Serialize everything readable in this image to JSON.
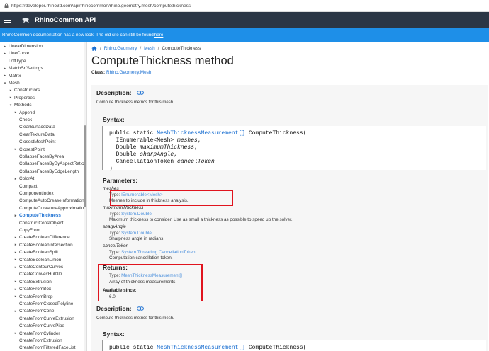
{
  "browser": {
    "url": "https://developer.rhino3d.com/api/rhinocommon/rhino.geometry.mesh/computethickness"
  },
  "header": {
    "title": "RhinoCommon API"
  },
  "notice": {
    "text": "RhinoCommon documentation has a new look. The old site can still be found ",
    "link": "here"
  },
  "sidebar": {
    "items": [
      {
        "label": "LinearDimension",
        "indent": 1,
        "toggle": "▸"
      },
      {
        "label": "LineCurve",
        "indent": 1,
        "toggle": "▸"
      },
      {
        "label": "LoftType",
        "indent": 1,
        "toggle": ""
      },
      {
        "label": "MatchSrfSettings",
        "indent": 1,
        "toggle": "▸"
      },
      {
        "label": "Matrix",
        "indent": 1,
        "toggle": "▸"
      },
      {
        "label": "Mesh",
        "indent": 1,
        "toggle": "▾"
      },
      {
        "label": "Constructors",
        "indent": 2,
        "toggle": "▸"
      },
      {
        "label": "Properties",
        "indent": 2,
        "toggle": "▸"
      },
      {
        "label": "Methods",
        "indent": 2,
        "toggle": "▾"
      },
      {
        "label": "Append",
        "indent": 3,
        "toggle": "▸"
      },
      {
        "label": "Check",
        "indent": 3,
        "toggle": ""
      },
      {
        "label": "ClearSurfaceData",
        "indent": 3,
        "toggle": ""
      },
      {
        "label": "ClearTextureData",
        "indent": 3,
        "toggle": ""
      },
      {
        "label": "ClosestMeshPoint",
        "indent": 3,
        "toggle": ""
      },
      {
        "label": "ClosestPoint",
        "indent": 3,
        "toggle": "▸"
      },
      {
        "label": "CollapseFacesByArea",
        "indent": 3,
        "toggle": ""
      },
      {
        "label": "CollapseFacesByByAspectRatio",
        "indent": 3,
        "toggle": ""
      },
      {
        "label": "CollapseFacesByEdgeLength",
        "indent": 3,
        "toggle": ""
      },
      {
        "label": "ColorAt",
        "indent": 3,
        "toggle": "▸"
      },
      {
        "label": "Compact",
        "indent": 3,
        "toggle": ""
      },
      {
        "label": "ComponentIndex",
        "indent": 3,
        "toggle": ""
      },
      {
        "label": "ComputeAutoCreaseInformation",
        "indent": 3,
        "toggle": ""
      },
      {
        "label": "ComputeCurvatureApproximation",
        "indent": 3,
        "toggle": ""
      },
      {
        "label": "ComputeThickness",
        "indent": 3,
        "toggle": "▸",
        "active": true
      },
      {
        "label": "ConstructConstObject",
        "indent": 3,
        "toggle": ""
      },
      {
        "label": "CopyFrom",
        "indent": 3,
        "toggle": ""
      },
      {
        "label": "CreateBooleanDifference",
        "indent": 3,
        "toggle": "▸"
      },
      {
        "label": "CreateBooleanIntersection",
        "indent": 3,
        "toggle": "▸"
      },
      {
        "label": "CreateBooleanSplit",
        "indent": 3,
        "toggle": "▸"
      },
      {
        "label": "CreateBooleanUnion",
        "indent": 3,
        "toggle": "▸"
      },
      {
        "label": "CreateContourCurves",
        "indent": 3,
        "toggle": "▸"
      },
      {
        "label": "CreateConvexHull3D",
        "indent": 3,
        "toggle": ""
      },
      {
        "label": "CreateExtrusion",
        "indent": 3,
        "toggle": "▸"
      },
      {
        "label": "CreateFromBox",
        "indent": 3,
        "toggle": "▸"
      },
      {
        "label": "CreateFromBrep",
        "indent": 3,
        "toggle": "▸"
      },
      {
        "label": "CreateFromClosedPolyline",
        "indent": 3,
        "toggle": ""
      },
      {
        "label": "CreateFromCone",
        "indent": 3,
        "toggle": "▸"
      },
      {
        "label": "CreateFromCurveExtrusion",
        "indent": 3,
        "toggle": ""
      },
      {
        "label": "CreateFromCurvePipe",
        "indent": 3,
        "toggle": ""
      },
      {
        "label": "CreateFromCylinder",
        "indent": 3,
        "toggle": "▸"
      },
      {
        "label": "CreateFromExtrusion",
        "indent": 3,
        "toggle": ""
      },
      {
        "label": "CreateFromFilteredFaceList",
        "indent": 3,
        "toggle": ""
      }
    ]
  },
  "breadcrumb": {
    "items": [
      "Rhino.Geometry",
      "Mesh"
    ],
    "current": "ComputeThickness"
  },
  "page": {
    "title": "ComputeThickness method",
    "class_label": "Class:",
    "class_value": "Rhino.Geometry.Mesh"
  },
  "section1": {
    "description_title": "Description:",
    "description_text": "Compute thickness metrics for this mesh.",
    "syntax_title": "Syntax:",
    "code": {
      "line1_pre": "public static ",
      "line1_type": "MeshThicknessMeasurement[]",
      "line1_post": " ComputeThickness(",
      "line2": "  IEnumerable<Mesh> ",
      "line2_param": "meshes",
      "line3": "  Double ",
      "line3_param": "maximumThickness",
      "line4": "  Double ",
      "line4_param": "sharpAngle",
      "line5": "  CancellationToken ",
      "line5_param": "cancelToken",
      "line6": ")"
    },
    "parameters_title": "Parameters:",
    "params": [
      {
        "name": "meshes",
        "type_label": "Type: ",
        "type": "IEnumerable<Mesh>",
        "desc": "Meshes to include in thickness analysis."
      },
      {
        "name": "maximumThickness",
        "type_label": "Type: ",
        "type": "System.Double",
        "desc": "Maximum thickness to consider. Use as small a thickness as possible to speed up the solver."
      },
      {
        "name": "sharpAngle",
        "type_label": "Type: ",
        "type": "System.Double",
        "desc": "Sharpness angle in radians."
      },
      {
        "name": "cancelToken",
        "type_label": "Type: ",
        "type": "System.Threading.CancellationToken",
        "desc": "Computation cancellation token."
      }
    ],
    "returns_title": "Returns:",
    "returns_type_label": "Type: ",
    "returns_type": "MeshThicknessMeasurement[]",
    "returns_desc": "Array of thickness measurements.",
    "available_label": "Available since:",
    "available_value": "6.0"
  },
  "section2": {
    "description_title": "Description:",
    "description_text": "Compute thickness metrics for this mesh.",
    "syntax_title": "Syntax:",
    "line1_pre": "public static ",
    "line1_type": "MeshThicknessMeasurement[]",
    "line1_post": " ComputeThickness("
  },
  "colors": {
    "header_bg": "#2b3645",
    "notice_bg": "#1e8fe8",
    "link": "#1a6fd1",
    "highlight": "#e0141e"
  }
}
